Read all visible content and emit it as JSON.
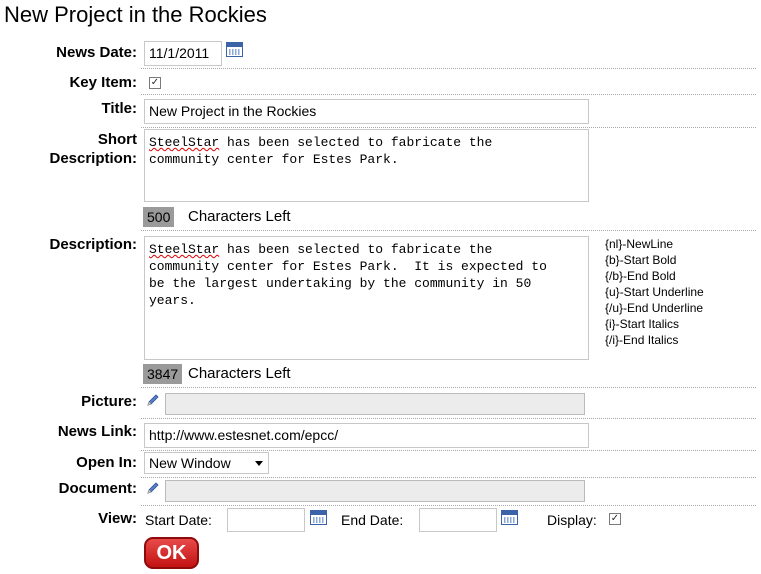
{
  "page": {
    "title": "New Project in the Rockies"
  },
  "fields": {
    "news_date": {
      "label": "News Date:",
      "value": "11/1/2011"
    },
    "key_item": {
      "label": "Key Item:",
      "checked": true
    },
    "title": {
      "label": "Title:",
      "value": "New Project in the Rockies"
    },
    "short_description": {
      "label_line1": "Short",
      "label_line2": "Description:",
      "value": "has been selected to fabricate the\ncommunity center for Estes Park.",
      "lead_word": "SteelStar",
      "chars_left": "500",
      "chars_left_label": "Characters Left"
    },
    "description": {
      "label": "Description:",
      "lead_word": "SteelStar",
      "value": "has been selected to fabricate the\ncommunity center for Estes Park.  It is expected to\nbe the largest undertaking by the community in 50\nyears.",
      "chars_left": "3847",
      "chars_left_label": "Characters Left"
    },
    "picture": {
      "label": "Picture:"
    },
    "news_link": {
      "label": "News Link:",
      "value": "http://www.estesnet.com/epcc/"
    },
    "open_in": {
      "label": "Open In:",
      "value": "New Window"
    },
    "document": {
      "label": "Document:"
    },
    "view": {
      "label": "View:",
      "start_date_label": "Start Date:",
      "start_date_value": "",
      "end_date_label": "End Date:",
      "end_date_value": "",
      "display_label": "Display:",
      "display_checked": true
    }
  },
  "format_legend": [
    "{nl}-NewLine",
    "{b}-Start Bold",
    "{/b}-End Bold",
    "{u}-Start Underline",
    "{/u}-End Underline",
    "{i}-Start Italics",
    "{/i}-End Italics"
  ],
  "buttons": {
    "ok": "OK"
  },
  "icons": {
    "calendar": "calendar-icon",
    "pencil": "pencil-icon",
    "checkbox": "checkmark-icon"
  }
}
